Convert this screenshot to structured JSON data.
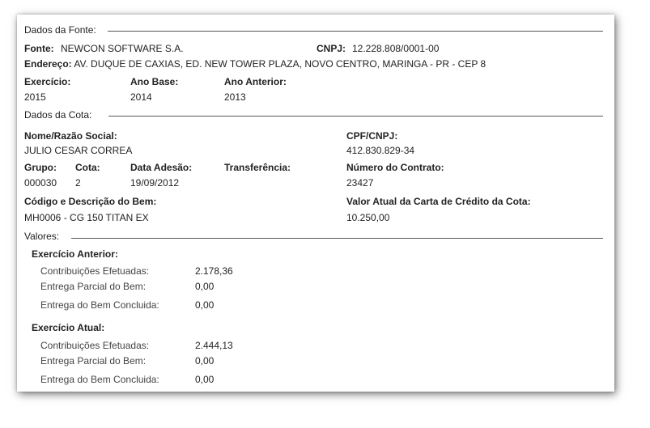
{
  "fonte": {
    "section_title": "Dados da Fonte:",
    "fonte_label": "Fonte:",
    "fonte_value": "NEWCON SOFTWARE S.A.",
    "cnpj_label": "CNPJ:",
    "cnpj_value": "12.228.808/0001-00",
    "endereco_label": "Endereço:",
    "endereco_value": "AV. DUQUE DE CAXIAS, ED. NEW TOWER PLAZA, NOVO CENTRO, MARINGA - PR - CEP 8",
    "exercicio_label": "Exercício:",
    "exercicio_value": "2015",
    "ano_base_label": "Ano Base:",
    "ano_base_value": "2014",
    "ano_anterior_label": "Ano Anterior:",
    "ano_anterior_value": "2013"
  },
  "cota": {
    "section_title": "Dados da Cota:",
    "nome_label": "Nome/Razão Social:",
    "nome_value": "JULIO CESAR CORREA",
    "cpf_label": "CPF/CNPJ:",
    "cpf_value": "412.830.829-34",
    "grupo_label": "Grupo:",
    "grupo_value": "000030",
    "cota_label": "Cota:",
    "cota_value": "2",
    "adesao_label": "Data Adesão:",
    "adesao_value": "19/09/2012",
    "transferencia_label": "Transferência:",
    "contrato_label": "Número do Contrato:",
    "contrato_value": "23427",
    "bem_label": "Código e Descrição do Bem:",
    "bem_value": "MH0006 - CG 150 TITAN EX",
    "carta_label": "Valor Atual da Carta de Crédito da Cota:",
    "carta_value": "10.250,00"
  },
  "valores": {
    "section_title": "Valores:",
    "anterior": {
      "title": "Exercício Anterior:",
      "rows": [
        {
          "label": "Contribuições Efetuadas:",
          "value": "2.178,36"
        },
        {
          "label": "Entrega Parcial do Bem:",
          "value": "0,00"
        },
        {
          "label": "Entrega do Bem Concluida:",
          "value": "0,00"
        }
      ]
    },
    "atual": {
      "title": "Exercício Atual:",
      "rows": [
        {
          "label": "Contribuições Efetuadas:",
          "value": "2.444,13"
        },
        {
          "label": "Entrega Parcial do Bem:",
          "value": "0,00"
        },
        {
          "label": "Entrega do Bem Concluida:",
          "value": "0,00"
        }
      ]
    }
  }
}
